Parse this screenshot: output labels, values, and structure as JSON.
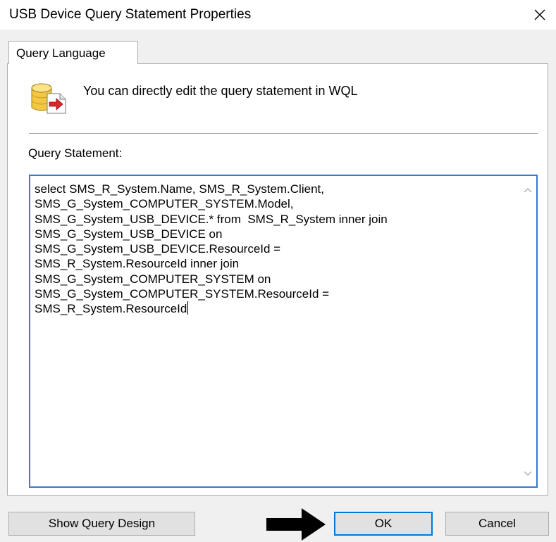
{
  "window": {
    "title": "USB Device Query Statement Properties"
  },
  "tab": {
    "label": "Query Language"
  },
  "info": {
    "text": "You can directly edit the query statement in WQL",
    "icon": "database-export-icon"
  },
  "query": {
    "label": "Query Statement:",
    "lines": [
      "select SMS_R_System.Name, SMS_R_System.Client,",
      "SMS_G_System_COMPUTER_SYSTEM.Model,",
      "SMS_G_System_USB_DEVICE.* from  SMS_R_System inner join",
      "SMS_G_System_USB_DEVICE on",
      "SMS_G_System_USB_DEVICE.ResourceId =",
      "SMS_R_System.ResourceId inner join",
      "SMS_G_System_COMPUTER_SYSTEM on",
      "SMS_G_System_COMPUTER_SYSTEM.ResourceId =",
      "SMS_R_System.ResourceId"
    ]
  },
  "buttons": {
    "show_query_design": "Show Query Design",
    "ok": "OK",
    "cancel": "Cancel"
  },
  "colors": {
    "focus_border": "#3a78d4",
    "button_face": "#e1e1e1",
    "dialog_bg": "#f0f0f0"
  }
}
